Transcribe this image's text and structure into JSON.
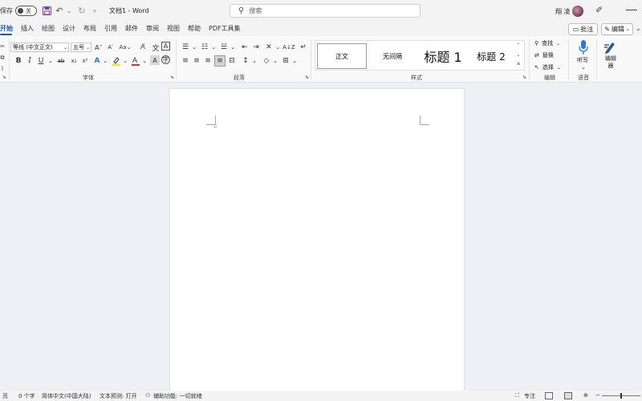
{
  "titlebar": {
    "autosave_label": "保存",
    "autosave_state": "关",
    "doc_title": "文档1 - Word",
    "search_placeholder": "搜索",
    "user_name": "翔 凌"
  },
  "menu": {
    "tabs": [
      "开始",
      "插入",
      "绘图",
      "设计",
      "布局",
      "引用",
      "邮件",
      "审阅",
      "视图",
      "帮助",
      "PDF工具集"
    ],
    "active_tab": "开始",
    "comment_label": "批注",
    "edit_label": "编辑"
  },
  "ribbon": {
    "font": {
      "name": "等线 (中文正文)",
      "size": "五号",
      "group_label": "字体"
    },
    "paragraph": {
      "group_label": "段落"
    },
    "styles": {
      "group_label": "样式",
      "items": [
        "正文",
        "无间隔",
        "标题 1",
        "标题 2"
      ]
    },
    "editing": {
      "group_label": "编辑",
      "find": "查找",
      "replace": "替换",
      "select": "选择"
    },
    "voice": {
      "group_label": "语音",
      "dictate": "听写"
    },
    "editor": {
      "label": "编辑器"
    }
  },
  "statusbar": {
    "page": "页",
    "word_count": "0 个字",
    "language": "简体中文(中国大陆)",
    "text_prediction": "文本预测: 打开",
    "accessibility": "辅助功能: 一切就绪",
    "focus": "专注"
  },
  "colors": {
    "accent": "#185abd",
    "highlight": "#ffe600",
    "font_color": "#d13438"
  }
}
